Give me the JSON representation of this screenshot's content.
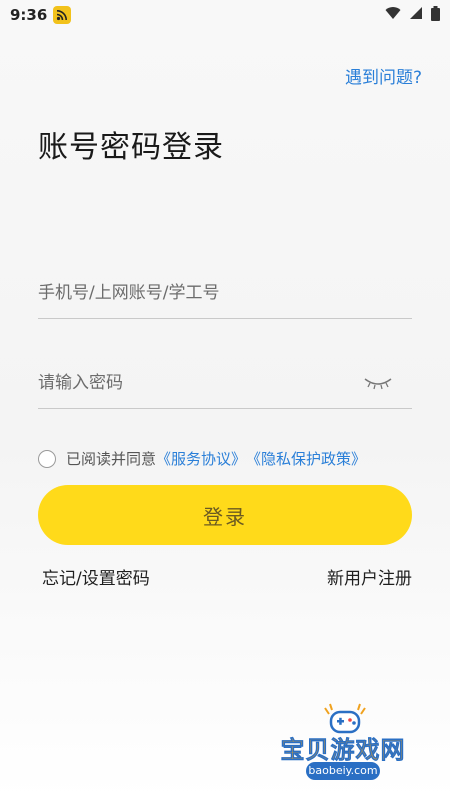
{
  "status_bar": {
    "time": "9:36"
  },
  "header": {
    "help_link": "遇到问题?",
    "title": "账号密码登录"
  },
  "form": {
    "account_placeholder": "手机号/上网账号/学工号",
    "password_placeholder": "请输入密码",
    "agreement_text": "已阅读并同意",
    "service_agreement_link": "《服务协议》",
    "privacy_policy_link": "《隐私保护政策》",
    "login_button": "登录"
  },
  "footer_links": {
    "forgot_password": "忘记/设置密码",
    "register": "新用户注册"
  },
  "watermark": {
    "title": "宝贝游戏网",
    "url": "baobeiy.com"
  },
  "colors": {
    "accent_yellow": "#ffda1a",
    "link_blue": "#2a7fd8"
  }
}
